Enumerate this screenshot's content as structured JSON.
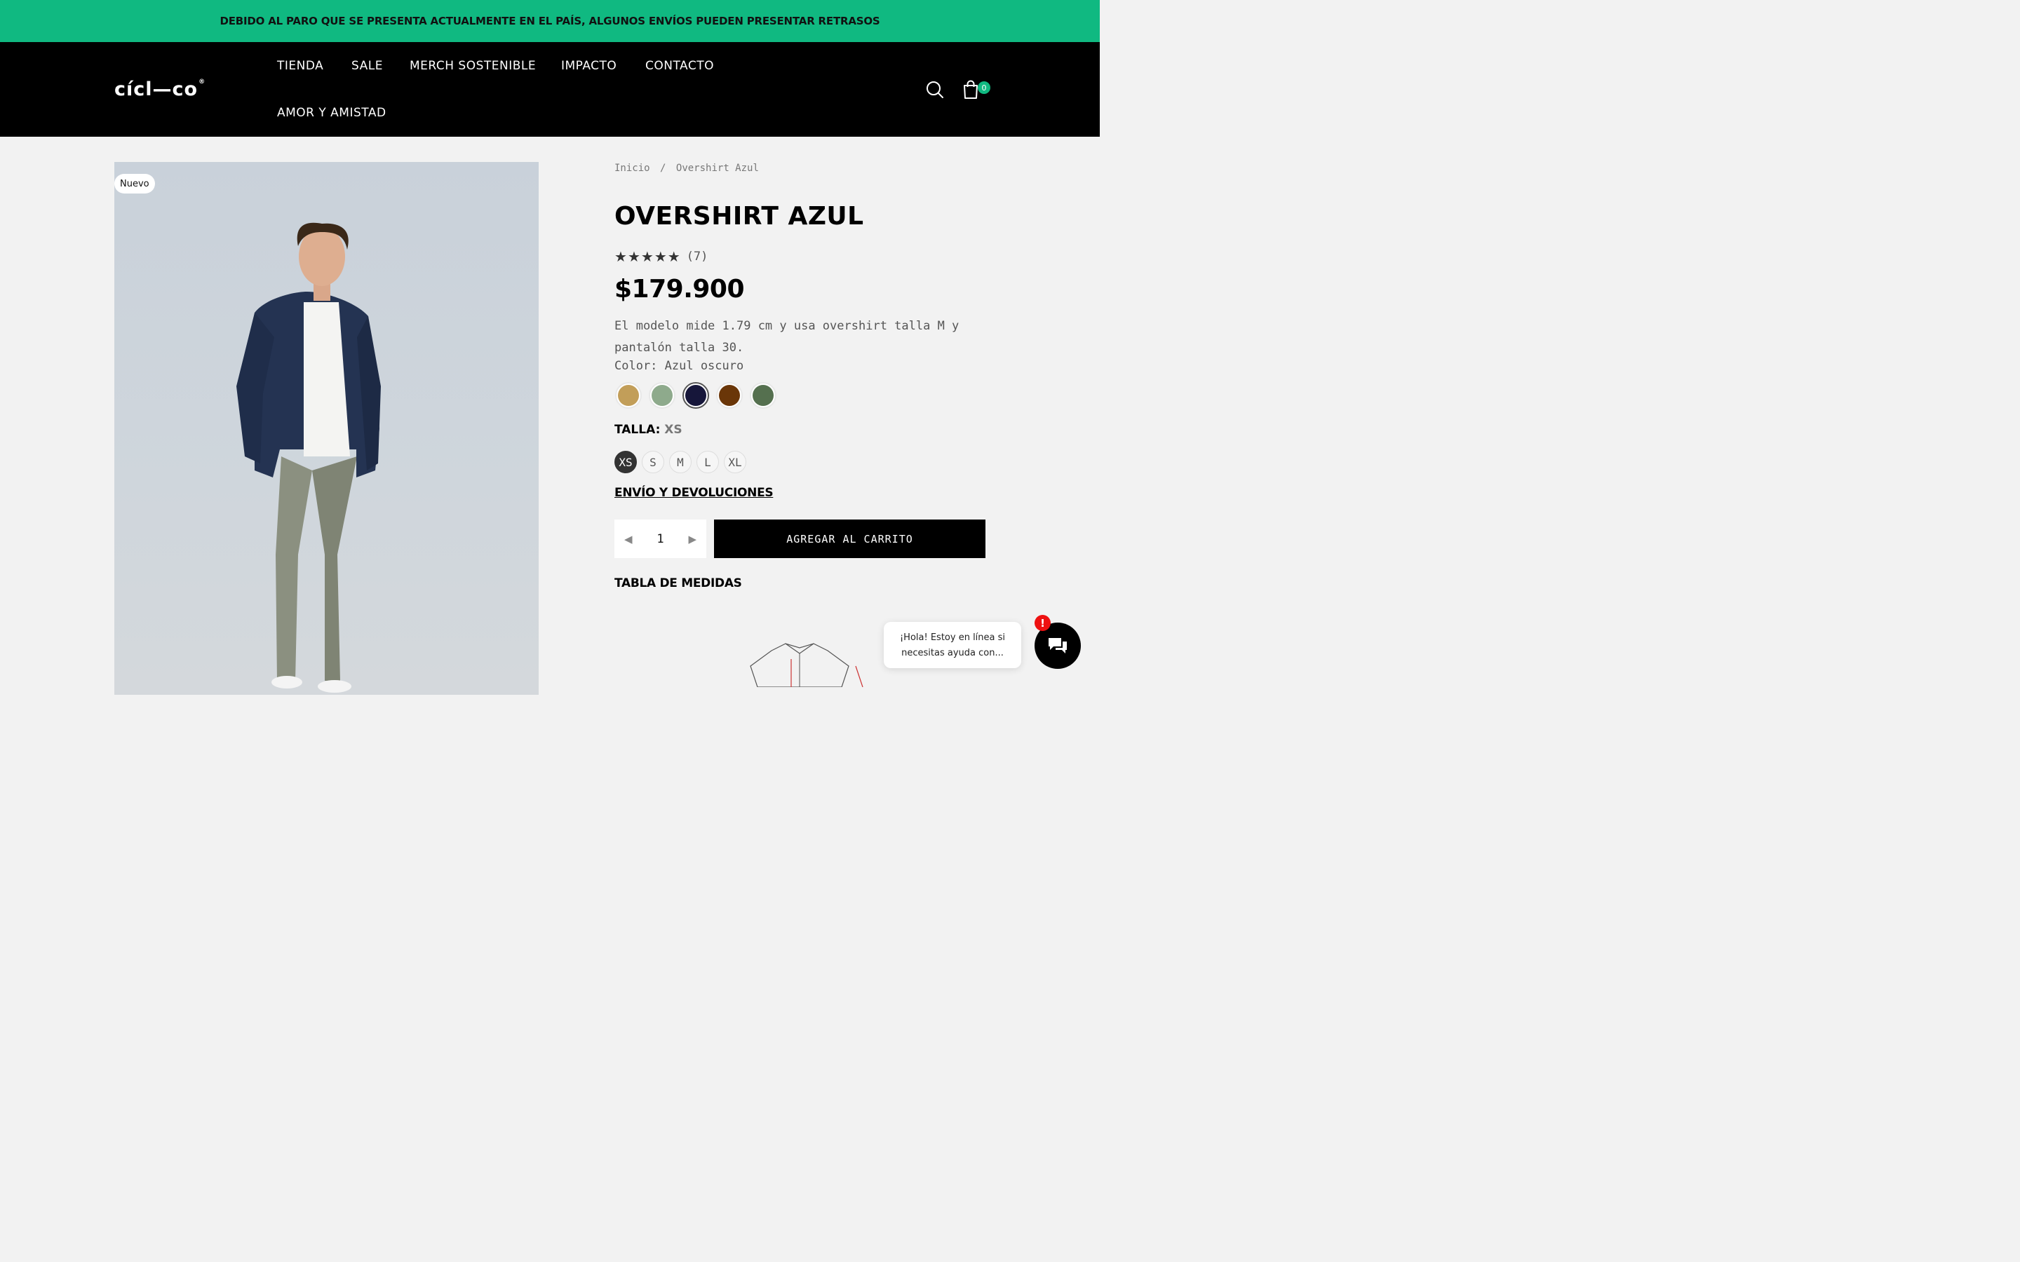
{
  "announcement": "DEBIDO AL PARO QUE SE PRESENTA ACTUALMENTE EN EL PAÍS, ALGUNOS ENVÍOS PUEDEN PRESENTAR RETRASOS",
  "header": {
    "logo": "cícl—co",
    "logo_mark": "®",
    "nav": [
      "TIENDA",
      "SALE",
      "MERCH SOSTENIBLE",
      "IMPACTO",
      "CONTACTO",
      "AMOR Y AMISTAD"
    ],
    "cart_count": "0",
    "icons": [
      "search-icon",
      "shopping-bag-icon"
    ]
  },
  "product": {
    "badge": "Nuevo",
    "breadcrumb": [
      "Inicio",
      "/",
      "Overshirt Azul"
    ],
    "title": "OVERSHIRT AZUL",
    "rating_stars": 5,
    "rating_count": "(7)",
    "price": "$179.900",
    "description": "El modelo mide 1.79 cm y usa overshirt talla M y pantalón talla 30.",
    "color_label": "Color: Azul oscuro",
    "colors": [
      "#c29e59",
      "#8eaa8c",
      "#16163a",
      "#6a3608",
      "#55704f"
    ],
    "selected_color_index": 2,
    "size_label": "TALLA:",
    "size_selected": "XS",
    "sizes": [
      "XS",
      "S",
      "M",
      "L",
      "XL"
    ],
    "shipping_link": "ENVÍO Y DEVOLUCIONES",
    "quantity": "1",
    "add_to_cart": "AGREGAR AL CARRITO",
    "size_chart_title": "TABLA DE MEDIDAS"
  },
  "chat": {
    "message": "¡Hola! Estoy en línea si necesitas ayuda con...",
    "alert": "!"
  },
  "colors": {
    "accent_green": "#10b981",
    "header_bg": "#000000",
    "page_bg": "#f2f2f2"
  }
}
